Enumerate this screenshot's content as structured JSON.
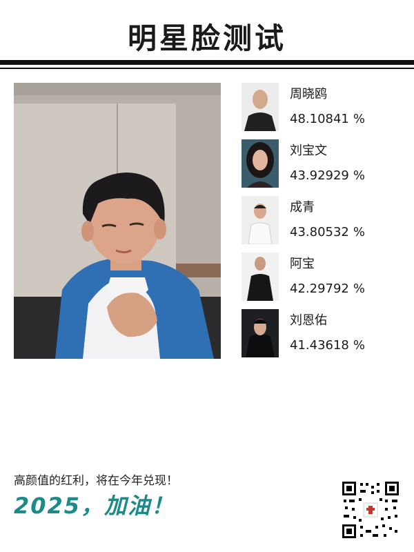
{
  "title": "明星脸测试",
  "matches": [
    {
      "name": "周晓鸥",
      "score": "48.10841",
      "unit": "%",
      "icon": "celebrity-portrait"
    },
    {
      "name": "刘宝文",
      "score": "43.92929",
      "unit": "%",
      "icon": "celebrity-portrait"
    },
    {
      "name": "成青",
      "score": "43.80532",
      "unit": "%",
      "icon": "celebrity-portrait"
    },
    {
      "name": "阿宝",
      "score": "42.29792",
      "unit": "%",
      "icon": "celebrity-portrait"
    },
    {
      "name": "刘恩佑",
      "score": "41.43618",
      "unit": "%",
      "icon": "celebrity-portrait"
    }
  ],
  "footer": {
    "slogan": "高颜值的红利，将在今年兑现！",
    "cheer": "2025，加油！"
  },
  "colors": {
    "accent": "#1a8a8a",
    "text": "#1a1a1a",
    "rule": "#111111"
  }
}
